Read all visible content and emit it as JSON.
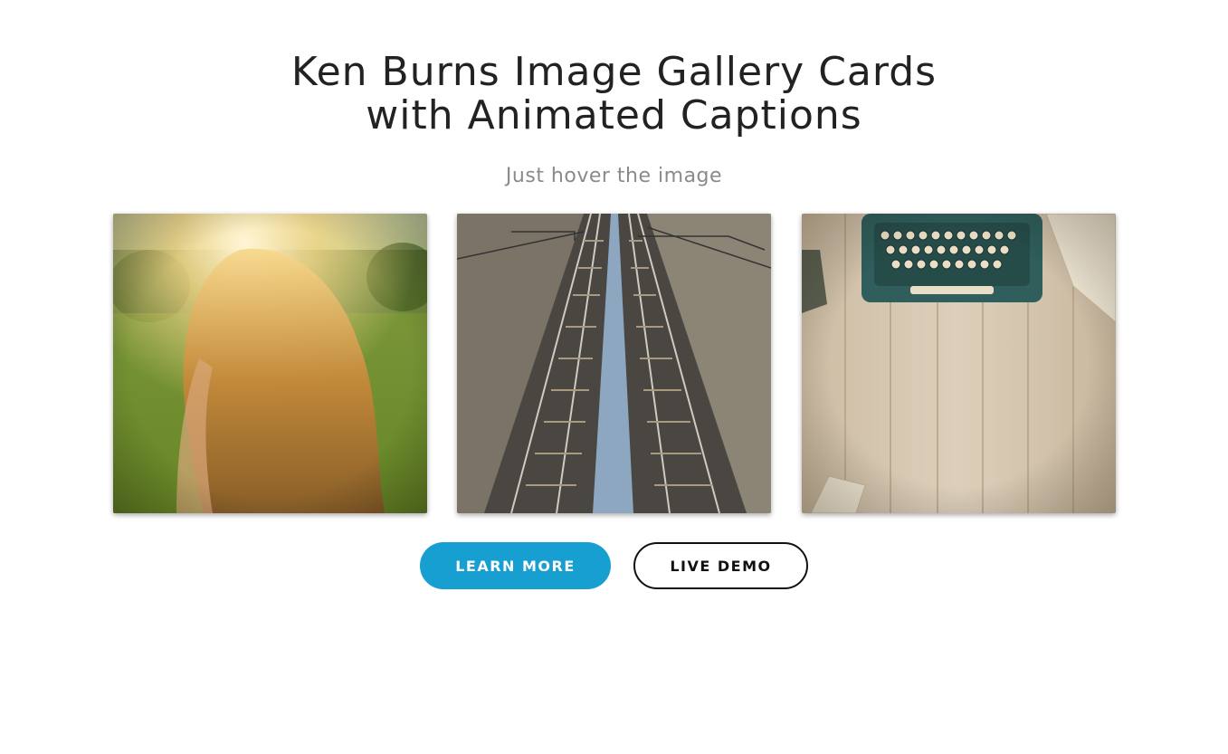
{
  "header": {
    "title_line1": "Ken Burns Image Gallery Cards",
    "title_line2": "with Animated Captions",
    "subtitle": "Just hover the image"
  },
  "gallery": {
    "cards": [
      {
        "image": "girl-in-sunlit-field"
      },
      {
        "image": "railway-tracks"
      },
      {
        "image": "typewriter-on-wooden-table"
      }
    ]
  },
  "buttons": {
    "learn_more": "LEARN MORE",
    "live_demo": "LIVE DEMO"
  },
  "colors": {
    "primary": "#169fd0",
    "text": "#222222",
    "subtitle": "#8a8a8a"
  }
}
